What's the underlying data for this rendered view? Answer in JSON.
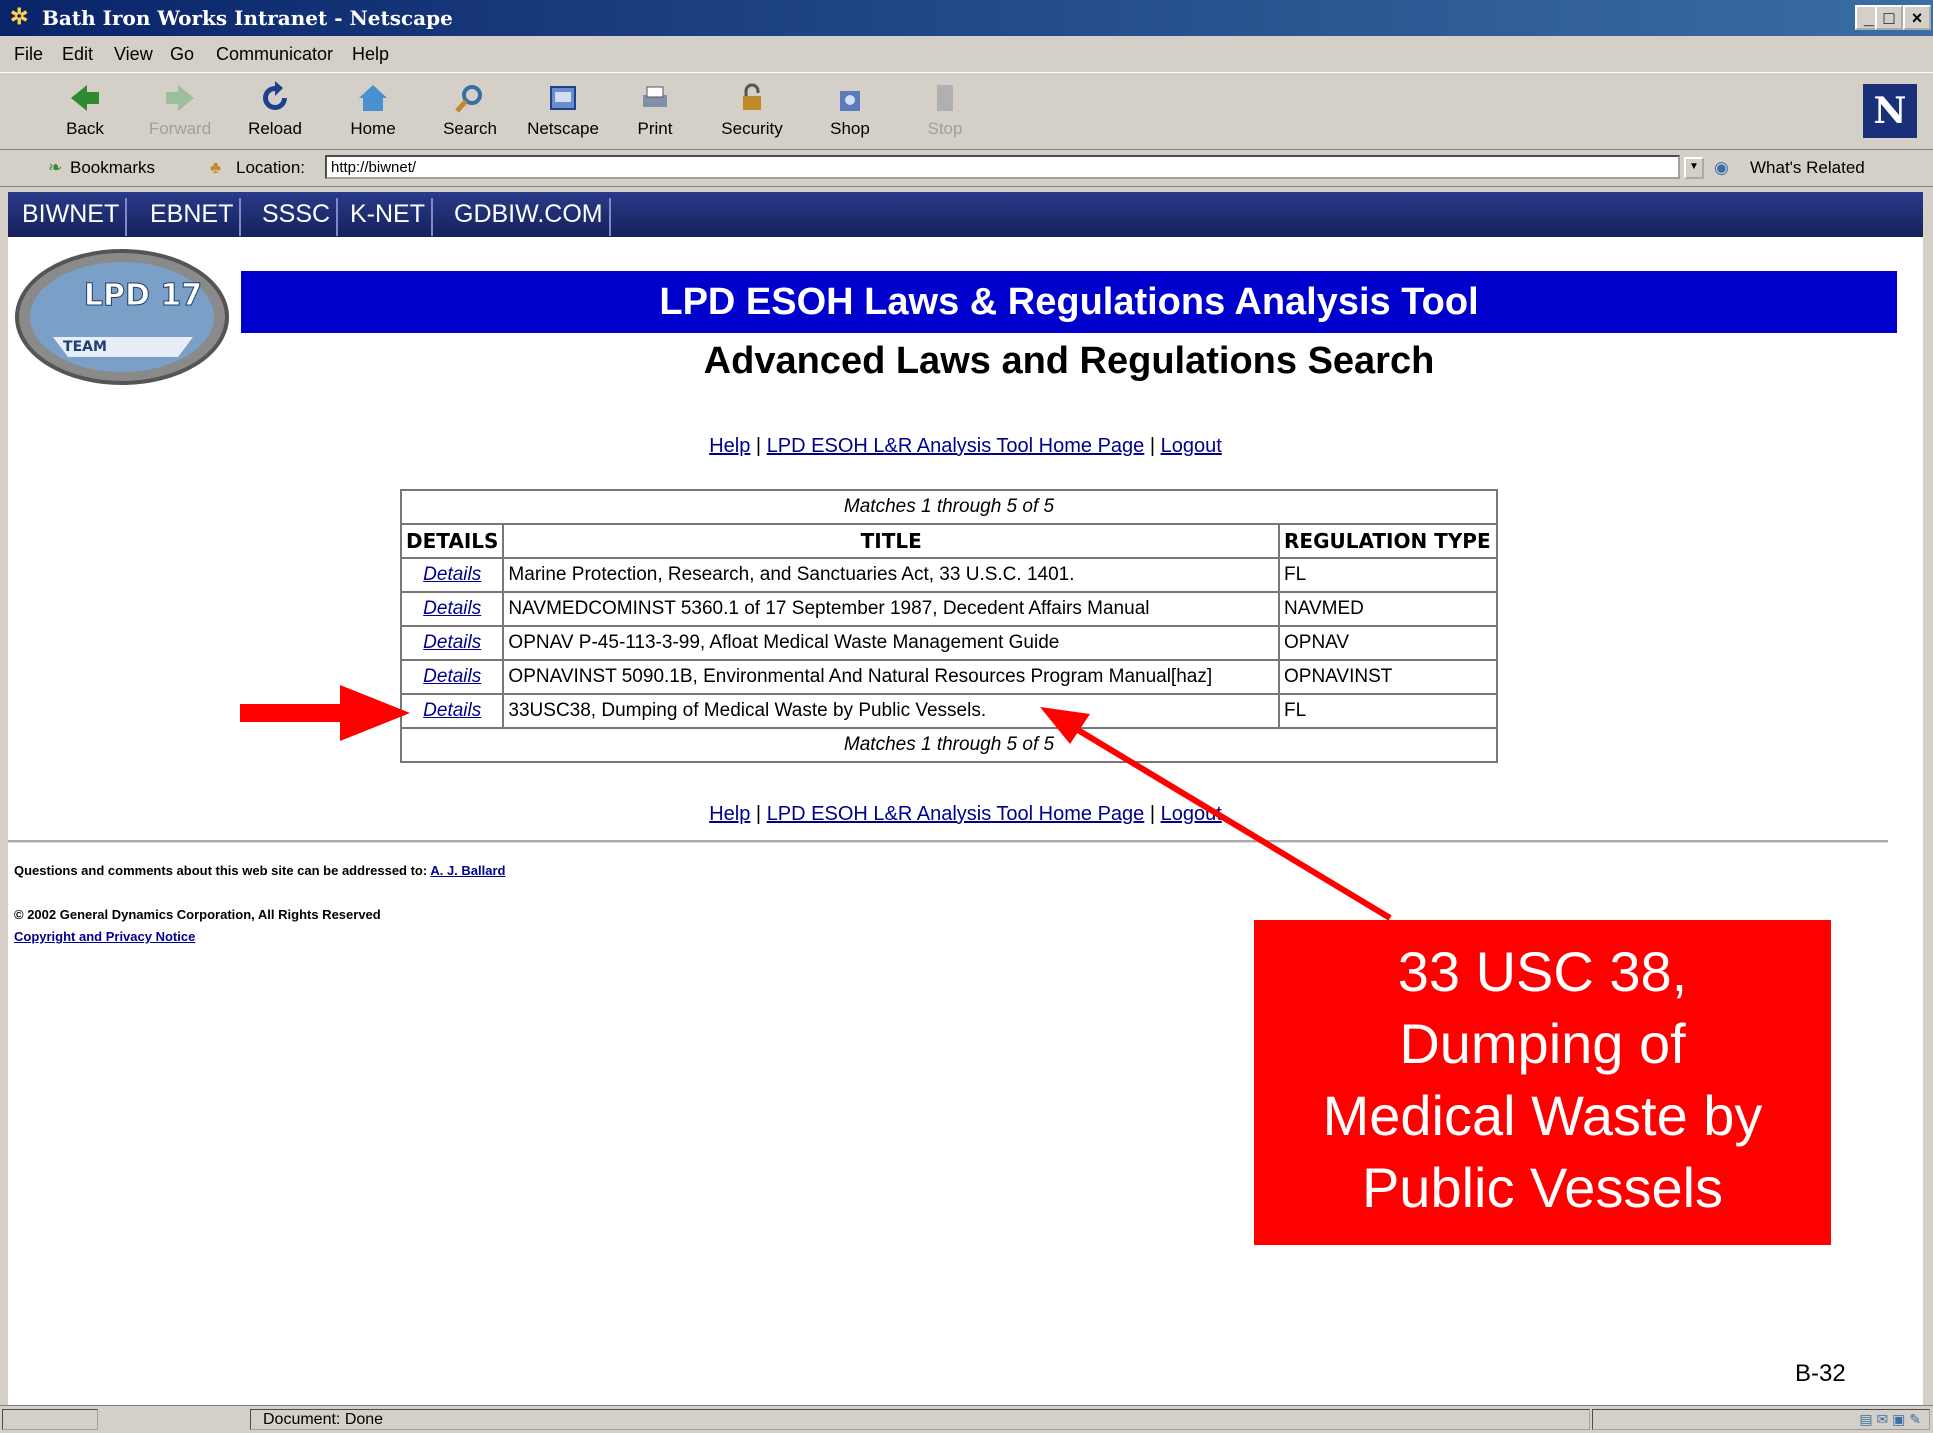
{
  "window": {
    "title": "Bath Iron Works Intranet - Netscape",
    "min": "_",
    "max": "□",
    "close": "×"
  },
  "menu": [
    "File",
    "Edit",
    "View",
    "Go",
    "Communicator",
    "Help"
  ],
  "toolbar": {
    "back": "Back",
    "forward": "Forward",
    "reload": "Reload",
    "home": "Home",
    "search": "Search",
    "netscape": "Netscape",
    "print": "Print",
    "security": "Security",
    "shop": "Shop",
    "stop": "Stop"
  },
  "location": {
    "bookmarks": "Bookmarks",
    "label": "Location:",
    "url": "http://biwnet/",
    "related": "What's Related"
  },
  "sitenav": [
    "BIWNET",
    "EBNET",
    "SSSC",
    "K-NET",
    "GDBIW.COM"
  ],
  "logo": {
    "text": "LPD 17",
    "sub": "TEAM"
  },
  "page": {
    "banner": "LPD ESOH Laws & Regulations Analysis Tool",
    "subtitle": "Advanced Laws and Regulations Search"
  },
  "links": {
    "help": "Help",
    "sep": " | ",
    "home": "LPD ESOH L&R Analysis Tool Home Page",
    "logout": "Logout"
  },
  "results": {
    "matches": "Matches 1 through 5 of 5",
    "headers": [
      "DETAILS",
      "TITLE",
      "REGULATION TYPE"
    ],
    "details_label": "Details",
    "rows": [
      {
        "title": "Marine Protection, Research, and Sanctuaries Act, 33 U.S.C. 1401.",
        "type": "FL"
      },
      {
        "title": "NAVMEDCOMINST 5360.1 of 17 September 1987, Decedent Affairs Manual",
        "type": "NAVMED"
      },
      {
        "title": "OPNAV P-45-113-3-99, Afloat Medical Waste Management Guide",
        "type": "OPNAV"
      },
      {
        "title": "OPNAVINST 5090.1B, Environmental And Natural Resources Program Manual[haz]",
        "type": "OPNAVINST"
      },
      {
        "title": "33USC38, Dumping of Medical Waste by Public Vessels.",
        "type": "FL"
      }
    ]
  },
  "footer": {
    "questions": "Questions and comments about this web site can be addressed to:",
    "contact": "A. J. Ballard",
    "copyright": "© 2002 General Dynamics Corporation, All Rights Reserved",
    "notice": "Copyright and Privacy Notice"
  },
  "callout": {
    "line1": "33 USC 38,",
    "line2": "Dumping of",
    "line3": "Medical Waste by",
    "line4": "Public Vessels"
  },
  "slide_number": "B-32",
  "status": {
    "text": "Document: Done"
  },
  "colors": {
    "callout": "#ff0000",
    "banner": "#0000cc",
    "nav": "#15225a"
  }
}
